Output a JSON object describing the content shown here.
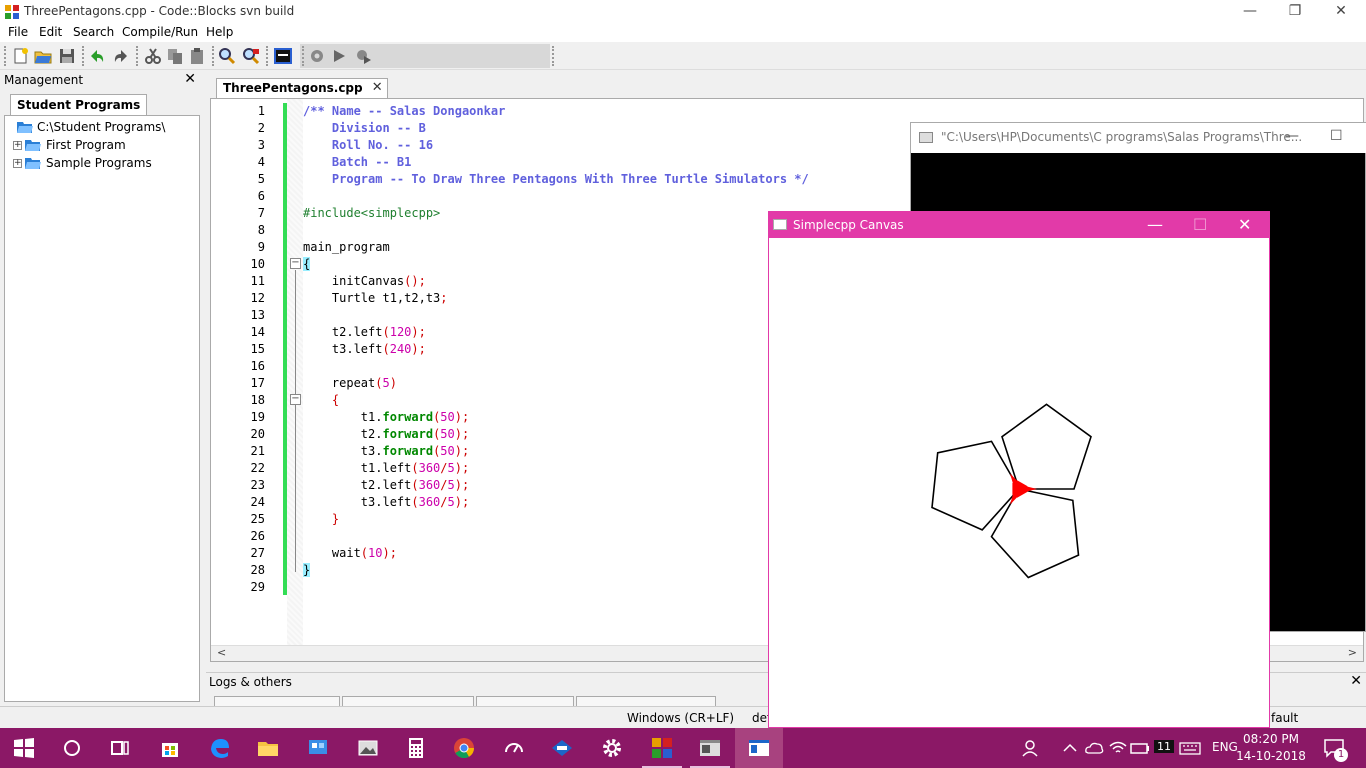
{
  "window": {
    "title": "ThreePentagons.cpp - Code::Blocks svn build",
    "minimize": "—",
    "restore": "❐",
    "close": "✕"
  },
  "menu": [
    "File",
    "Edit",
    "Search",
    "Compile/Run",
    "Help"
  ],
  "management": {
    "header": "Management",
    "close": "✕",
    "tab": "Student Programs",
    "tree": [
      {
        "label": "C:\\Student Programs\\",
        "expandable": false
      },
      {
        "label": "First Program",
        "expandable": true
      },
      {
        "label": "Sample Programs",
        "expandable": true
      }
    ],
    "expand_symbol": "+"
  },
  "editor": {
    "tab_label": "ThreePentagons.cpp",
    "tab_close": "✕",
    "line_numbers": [
      "1",
      "2",
      "3",
      "4",
      "5",
      "6",
      "7",
      "8",
      "9",
      "10",
      "11",
      "12",
      "13",
      "14",
      "15",
      "16",
      "17",
      "18",
      "19",
      "20",
      "21",
      "22",
      "23",
      "24",
      "25",
      "26",
      "27",
      "28",
      "29"
    ],
    "fold_symbol": "−",
    "scroll_left": "<",
    "scroll_right": ">"
  },
  "code": [
    [
      {
        "t": "/** Name -- Salas Dongaonkar",
        "c": "c-comment"
      }
    ],
    [
      {
        "t": "    Division -- B",
        "c": "c-comment"
      }
    ],
    [
      {
        "t": "    Roll No. -- 16",
        "c": "c-comment"
      }
    ],
    [
      {
        "t": "    Batch -- B1",
        "c": "c-comment"
      }
    ],
    [
      {
        "t": "    Program -- To Draw Three Pentagons With Three Turtle Simulators */",
        "c": "c-comment"
      }
    ],
    [],
    [
      {
        "t": "#include<simplecpp>",
        "c": "c-pre"
      }
    ],
    [],
    [
      {
        "t": "main_program",
        "c": ""
      }
    ],
    [
      {
        "t": "{",
        "c": "brace-hl"
      }
    ],
    [
      {
        "t": "    initCanvas",
        "c": ""
      },
      {
        "t": "();",
        "c": "c-op"
      }
    ],
    [
      {
        "t": "    Turtle t1,t2,t3",
        "c": ""
      },
      {
        "t": ";",
        "c": "c-op"
      }
    ],
    [],
    [
      {
        "t": "    t2.left",
        "c": ""
      },
      {
        "t": "(",
        "c": "c-op"
      },
      {
        "t": "120",
        "c": "c-num"
      },
      {
        "t": ");",
        "c": "c-op"
      }
    ],
    [
      {
        "t": "    t3.left",
        "c": ""
      },
      {
        "t": "(",
        "c": "c-op"
      },
      {
        "t": "240",
        "c": "c-num"
      },
      {
        "t": ");",
        "c": "c-op"
      }
    ],
    [],
    [
      {
        "t": "    repeat",
        "c": ""
      },
      {
        "t": "(",
        "c": "c-op"
      },
      {
        "t": "5",
        "c": "c-num"
      },
      {
        "t": ")",
        "c": "c-op"
      }
    ],
    [
      {
        "t": "    {",
        "c": "c-op"
      }
    ],
    [
      {
        "t": "        t1.",
        "c": ""
      },
      {
        "t": "forward",
        "c": "c-kw"
      },
      {
        "t": "(",
        "c": "c-op"
      },
      {
        "t": "50",
        "c": "c-num"
      },
      {
        "t": ");",
        "c": "c-op"
      }
    ],
    [
      {
        "t": "        t2.",
        "c": ""
      },
      {
        "t": "forward",
        "c": "c-kw"
      },
      {
        "t": "(",
        "c": "c-op"
      },
      {
        "t": "50",
        "c": "c-num"
      },
      {
        "t": ");",
        "c": "c-op"
      }
    ],
    [
      {
        "t": "        t3.",
        "c": ""
      },
      {
        "t": "forward",
        "c": "c-kw"
      },
      {
        "t": "(",
        "c": "c-op"
      },
      {
        "t": "50",
        "c": "c-num"
      },
      {
        "t": ");",
        "c": "c-op"
      }
    ],
    [
      {
        "t": "        t1.left",
        "c": ""
      },
      {
        "t": "(",
        "c": "c-op"
      },
      {
        "t": "360",
        "c": "c-num"
      },
      {
        "t": "/",
        "c": "c-op"
      },
      {
        "t": "5",
        "c": "c-num"
      },
      {
        "t": ");",
        "c": "c-op"
      }
    ],
    [
      {
        "t": "        t2.left",
        "c": ""
      },
      {
        "t": "(",
        "c": "c-op"
      },
      {
        "t": "360",
        "c": "c-num"
      },
      {
        "t": "/",
        "c": "c-op"
      },
      {
        "t": "5",
        "c": "c-num"
      },
      {
        "t": ");",
        "c": "c-op"
      }
    ],
    [
      {
        "t": "        t3.left",
        "c": ""
      },
      {
        "t": "(",
        "c": "c-op"
      },
      {
        "t": "360",
        "c": "c-num"
      },
      {
        "t": "/",
        "c": "c-op"
      },
      {
        "t": "5",
        "c": "c-num"
      },
      {
        "t": ");",
        "c": "c-op"
      }
    ],
    [
      {
        "t": "    }",
        "c": "c-op"
      }
    ],
    [],
    [
      {
        "t": "    wait",
        "c": ""
      },
      {
        "t": "(",
        "c": "c-op"
      },
      {
        "t": "10",
        "c": "c-num"
      },
      {
        "t": ");",
        "c": "c-op"
      }
    ],
    [
      {
        "t": "}",
        "c": "brace-hl"
      }
    ],
    []
  ],
  "logs": {
    "header": "Logs & others",
    "close": "✕"
  },
  "status": {
    "line_endings": "Windows (CR+LF)",
    "encoding_partial": "def",
    "right_partial": "fault"
  },
  "console": {
    "title": "\"C:\\Users\\HP\\Documents\\C programs\\Salas Programs\\Thre...",
    "minimize": "—",
    "maximize": "☐"
  },
  "canvas": {
    "title": "Simplecpp Canvas",
    "minimize": "—",
    "maximize": "☐",
    "close": "✕",
    "stroke_color": "#000000",
    "turtle_color": "#ff0000",
    "background_color": "#ffffff",
    "turtle_steps": 5,
    "step_length": 50,
    "turn_angle": 72,
    "turtle_headings": [
      0,
      120,
      240
    ]
  },
  "taskbar": {
    "tray_badge": "11",
    "language": "ENG",
    "time": "08:20 PM",
    "date": "14-10-2018",
    "notification_count": "1"
  },
  "colors": {
    "canvas_title": "#e23aa8",
    "taskbar": "#8b1866",
    "change_bar": "#33dd55",
    "comment": "#6060dd"
  }
}
